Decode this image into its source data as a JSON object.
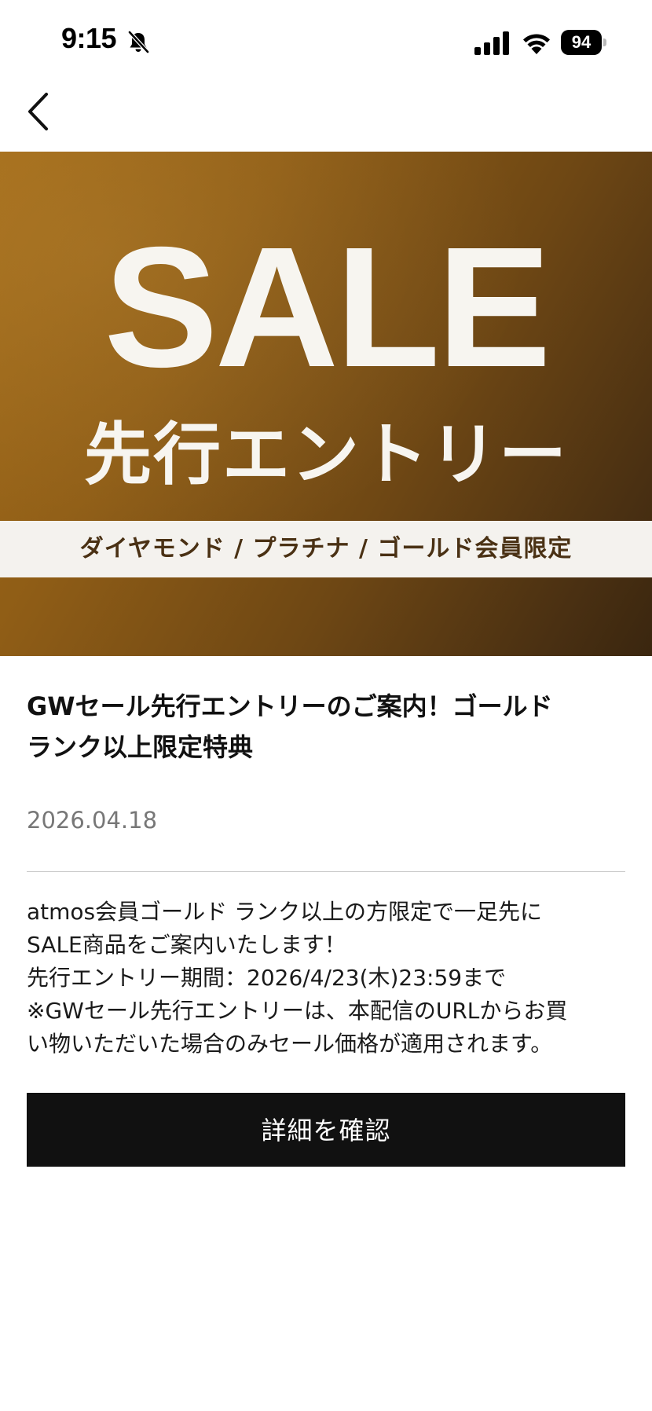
{
  "status_bar": {
    "time": "9:15",
    "battery_level": "94",
    "icons": [
      "bell-muted-icon",
      "signal-icon",
      "wifi-icon",
      "battery-icon"
    ]
  },
  "nav": {
    "back_icon": "chevron-left-icon"
  },
  "banner": {
    "headline": "SALE",
    "subtitle": "先行エントリー",
    "strip_text": "ダイヤモンド / プラチナ / ゴールド会員限定",
    "colors": {
      "gradient_start": "#a26b19",
      "gradient_end": "#3a260f",
      "text": "#f7f5f0",
      "strip_text": "#4a3114"
    }
  },
  "article": {
    "title_lines": [
      "GWセール先行エントリーのご案内！ゴールド",
      "ランク以上限定特典"
    ],
    "date": "2026.04.18",
    "body_lines": [
      "atmos会員ゴールド ランク以上の方限定で一足先に",
      "SALE商品をご案内いたします！",
      "先行エントリー期間：2026/4/23(木)23:59まで",
      "※GWセール先行エントリーは、本配信のURLからお買",
      "い物いただいた場合のみセール価格が適用されます。"
    ]
  },
  "actions": {
    "detail_button_label": "詳細を確認",
    "button_color": "#111111"
  }
}
